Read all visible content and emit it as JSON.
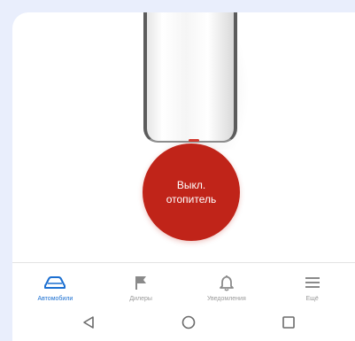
{
  "heater_button": {
    "line1": "Выкл.",
    "line2": "отопитель"
  },
  "tabs": [
    {
      "label": "Автомобили",
      "icon": "car-icon",
      "active": true
    },
    {
      "label": "Дилеры",
      "icon": "flag-icon",
      "active": false
    },
    {
      "label": "Уведомления",
      "icon": "bell-icon",
      "active": false
    },
    {
      "label": "Ещё",
      "icon": "menu-icon",
      "active": false
    }
  ],
  "system_nav": {
    "back": "back-icon",
    "home": "home-icon",
    "recents": "recents-icon"
  },
  "colors": {
    "accent": "#1b6fd1",
    "heater": "#c02419",
    "inactive": "#9a9a9a"
  }
}
